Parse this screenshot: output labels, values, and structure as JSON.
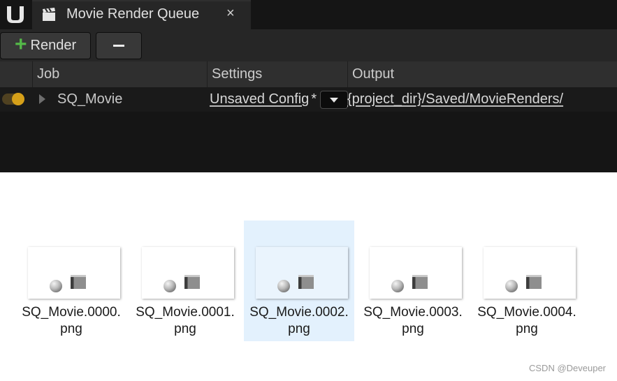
{
  "tab": {
    "title": "Movie Render Queue",
    "close_glyph": "×"
  },
  "toolbar": {
    "render_label": "Render",
    "render_icon": "plus-icon",
    "remove_icon": "minus-icon"
  },
  "columns": {
    "job": "Job",
    "settings": "Settings",
    "output": "Output"
  },
  "job": {
    "name": "SQ_Movie",
    "config": "Unsaved Config",
    "config_mark": "*",
    "output": "{project_dir}/Saved/MovieRenders/"
  },
  "files": [
    {
      "name": "SQ_Movie.0000.",
      "ext": "png",
      "selected": false
    },
    {
      "name": "SQ_Movie.0001.",
      "ext": "png",
      "selected": false
    },
    {
      "name": "SQ_Movie.0002.",
      "ext": "png",
      "selected": true
    },
    {
      "name": "SQ_Movie.0003.",
      "ext": "png",
      "selected": false
    },
    {
      "name": "SQ_Movie.0004.",
      "ext": "png",
      "selected": false
    }
  ],
  "watermark": "CSDN @Deveuper",
  "colors": {
    "panel_bg": "#151515",
    "accent_toggle": "#d6a019",
    "render_plus": "#54b948",
    "selected_bg": "#e3f1fd"
  }
}
